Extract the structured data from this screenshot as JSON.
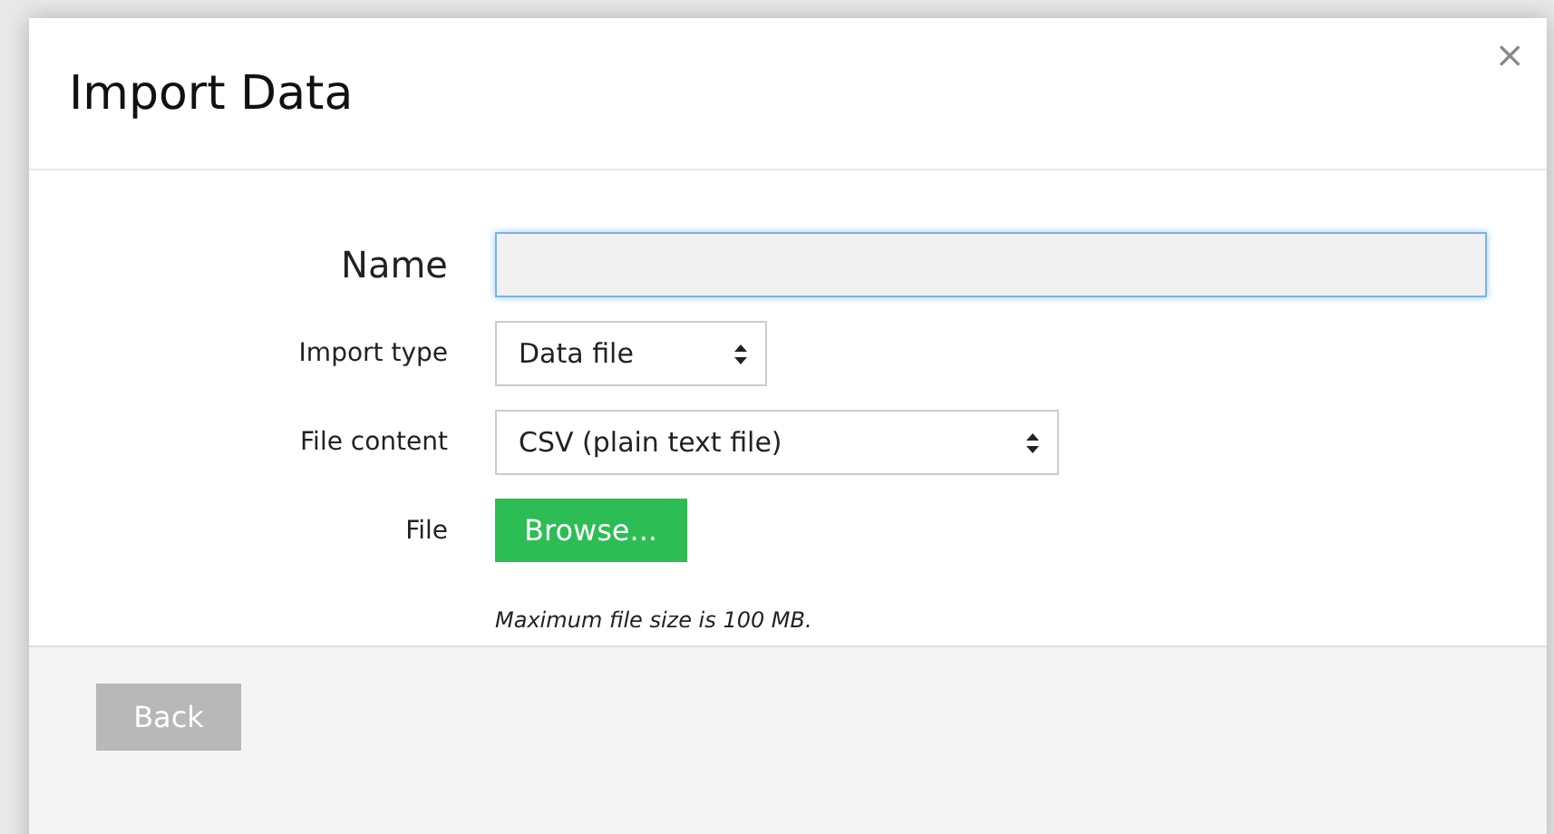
{
  "dialog": {
    "title": "Import Data",
    "close": "×"
  },
  "fields": [
    {
      "kind": "text",
      "label": "Name",
      "focused": true
    },
    {
      "kind": "select",
      "label": "Import type",
      "value": "Data file"
    },
    {
      "kind": "select",
      "label": "File content",
      "value": "CSV (plain text file)"
    },
    {
      "kind": "file",
      "label": "File",
      "button": "Browse...",
      "note": "Maximum file size is 100 MB."
    }
  ],
  "footer": {
    "back_button": {
      "label": "Back",
      "disabled": true
    }
  }
}
